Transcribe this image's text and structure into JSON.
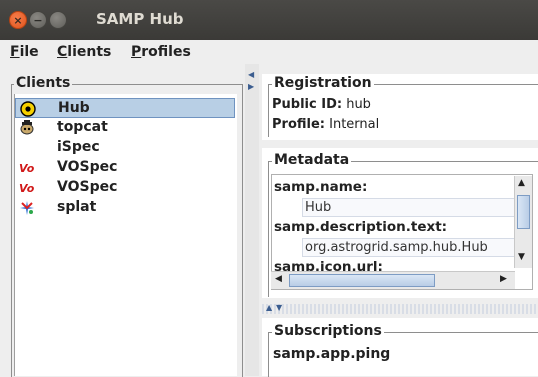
{
  "window": {
    "title": "SAMP Hub"
  },
  "menubar": {
    "items": [
      {
        "label": "File",
        "mnemonic": "F",
        "rest": "ile"
      },
      {
        "label": "Clients",
        "mnemonic": "C",
        "rest": "lients"
      },
      {
        "label": "Profiles",
        "mnemonic": "P",
        "rest": "rofiles"
      }
    ]
  },
  "clients": {
    "group_title": "Clients",
    "items": [
      {
        "label": "Hub",
        "icon": "hub-icon",
        "selected": true
      },
      {
        "label": "topcat",
        "icon": "topcat-icon",
        "selected": false
      },
      {
        "label": "iSpec",
        "icon": "",
        "selected": false
      },
      {
        "label": "VOSpec",
        "icon": "vospec-icon",
        "selected": false
      },
      {
        "label": "VOSpec",
        "icon": "vospec-icon",
        "selected": false
      },
      {
        "label": "splat",
        "icon": "splat-icon",
        "selected": false
      }
    ]
  },
  "registration": {
    "group_title": "Registration",
    "public_id_label": "Public ID:",
    "public_id": "hub",
    "profile_label": "Profile:",
    "profile": "Internal"
  },
  "metadata": {
    "group_title": "Metadata",
    "entries": [
      {
        "key": "samp.name:",
        "value": "Hub"
      },
      {
        "key": "samp.description.text:",
        "value": "org.astrogrid.samp.hub.Hub"
      },
      {
        "key": "samp.icon.url:",
        "value": ""
      }
    ]
  },
  "subscriptions": {
    "group_title": "Subscriptions",
    "items": [
      "samp.app.ping"
    ]
  },
  "colors": {
    "selection": "#b8cfe5",
    "titlebar": "#3b3a37",
    "close": "#e0541d"
  }
}
